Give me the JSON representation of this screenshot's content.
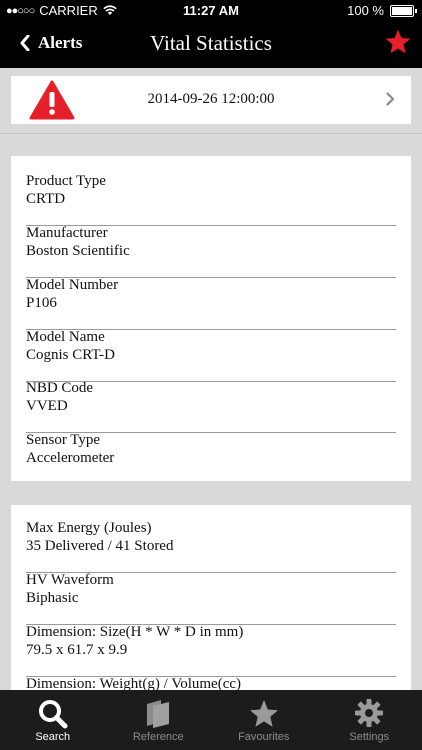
{
  "status_bar": {
    "carrier": "CARRIER",
    "time": "11:27 AM",
    "battery": "100 %"
  },
  "nav": {
    "back_label": "Alerts",
    "title": "Vital Statistics",
    "favourite_icon": "star-icon"
  },
  "alert": {
    "icon": "warning-icon",
    "datetime": "2014-09-26 12:00:00"
  },
  "device_info": [
    {
      "label": "Product Type",
      "value": "CRTD"
    },
    {
      "label": "Manufacturer",
      "value": "Boston Scientific"
    },
    {
      "label": "Model Number",
      "value": "P106"
    },
    {
      "label": "Model Name",
      "value": "Cognis CRT-D"
    },
    {
      "label": "NBD Code",
      "value": "VVED"
    },
    {
      "label": "Sensor Type",
      "value": "Accelerometer"
    }
  ],
  "specs": [
    {
      "label": "Max Energy (Joules)",
      "value": "35 Delivered / 41 Stored"
    },
    {
      "label": "HV Waveform",
      "value": "Biphasic"
    },
    {
      "label": "Dimension: Size(H * W * D in mm)",
      "value": "79.5 x 61.7 x 9.9"
    },
    {
      "label": "Dimension: Weight(g) / Volume(cc)",
      "value": ""
    }
  ],
  "tabs": [
    {
      "label": "Search",
      "icon": "search-icon",
      "active": true
    },
    {
      "label": "Reference",
      "icon": "book-icon",
      "active": false
    },
    {
      "label": "Favourites",
      "icon": "star-icon",
      "active": false
    },
    {
      "label": "Settings",
      "icon": "gear-icon",
      "active": false
    }
  ],
  "colors": {
    "accent_red": "#e5202a",
    "tab_active": "#ffffff",
    "tab_inactive": "#8c8c8c"
  }
}
